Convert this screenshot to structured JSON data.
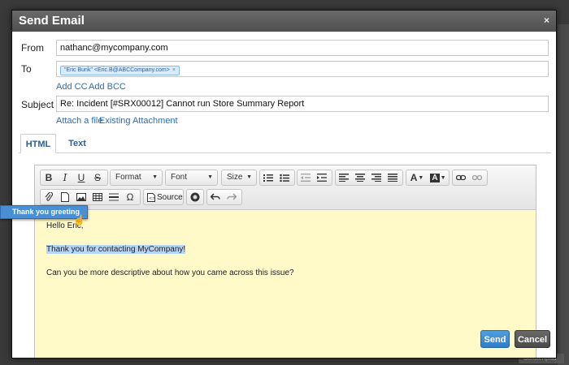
{
  "dialog": {
    "title": "Send Email",
    "close_glyph": "×"
  },
  "form": {
    "from_label": "From",
    "from_value": "nathanc@mycompany.com",
    "to_label": "To",
    "to_recipient": "\"Eric Bunk\" <Eric.B@ABCCompany.com>",
    "chip_remove": "×",
    "add_cc": "Add CC",
    "add_bcc": "Add BCC",
    "subject_label": "Subject",
    "subject_value": "Re:  Incident [#SRX00012] Cannot run Store Summary Report",
    "attach_file": "Attach a file",
    "existing_attachment": "Existing Attachment"
  },
  "tabs": [
    {
      "label": "HTML",
      "active": true
    },
    {
      "label": "Text",
      "active": false
    }
  ],
  "toolbar": {
    "bold": "B",
    "italic": "I",
    "underline": "U",
    "strike": "S",
    "format": "Format",
    "font": "Font",
    "size": "Size",
    "source": "Source",
    "omega": "Ω",
    "font_color": "A",
    "bg_color": "A"
  },
  "editor": {
    "lines": [
      "Hello Eric,",
      "Thank you for contacting MyCompany!",
      "Can you be more descriptive about how you came across this issue?"
    ]
  },
  "popup": {
    "label": "Thank you greeting"
  },
  "buttons": {
    "send": "Send",
    "cancel": "Cancel"
  },
  "background": {
    "tag": "Scratchpad"
  },
  "colors": {
    "title_bar": "#5a5a5a",
    "link": "#2a6db2",
    "send_button": "#3a8ad4",
    "editor_bg": "#fffac8",
    "highlight": "#b6d6f6"
  }
}
